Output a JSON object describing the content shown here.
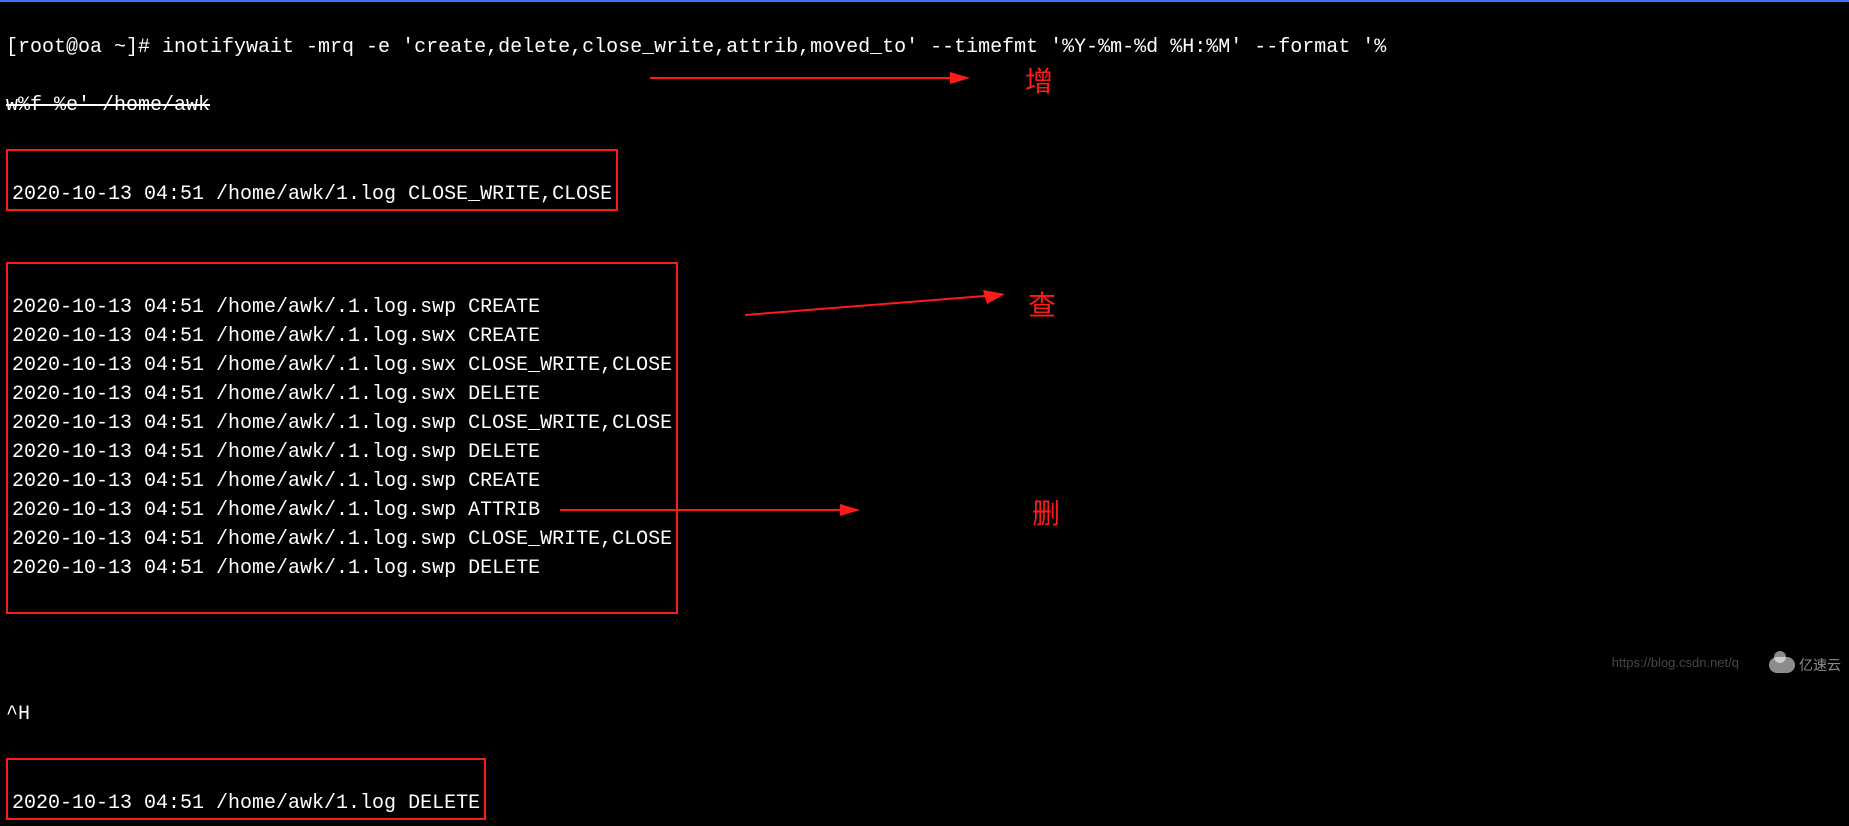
{
  "command_line1": "[root@oa ~]# inotifywait -mrq -e 'create,delete,close_write,attrib,moved_to' --timefmt '%Y-%m-%d %H:%M' --format '%",
  "command_line2": "w%f %e' /home/awk",
  "box1_line": "2020-10-13 04:51 /home/awk/1.log CLOSE_WRITE,CLOSE",
  "box2_lines": [
    "2020-10-13 04:51 /home/awk/.1.log.swp CREATE",
    "2020-10-13 04:51 /home/awk/.1.log.swx CREATE",
    "2020-10-13 04:51 /home/awk/.1.log.swx CLOSE_WRITE,CLOSE",
    "2020-10-13 04:51 /home/awk/.1.log.swx DELETE",
    "2020-10-13 04:51 /home/awk/.1.log.swp CLOSE_WRITE,CLOSE",
    "2020-10-13 04:51 /home/awk/.1.log.swp DELETE",
    "2020-10-13 04:51 /home/awk/.1.log.swp CREATE",
    "2020-10-13 04:51 /home/awk/.1.log.swp ATTRIB",
    "2020-10-13 04:51 /home/awk/.1.log.swp CLOSE_WRITE,CLOSE",
    "2020-10-13 04:51 /home/awk/.1.log.swp DELETE"
  ],
  "ctrl_h": "^H",
  "box3_line": "2020-10-13 04:51 /home/awk/1.log DELETE",
  "annotation1": "增",
  "annotation2": "查",
  "annotation3": "删",
  "watermark_url": "https://blog.csdn.net/q",
  "watermark_brand": "亿速云"
}
